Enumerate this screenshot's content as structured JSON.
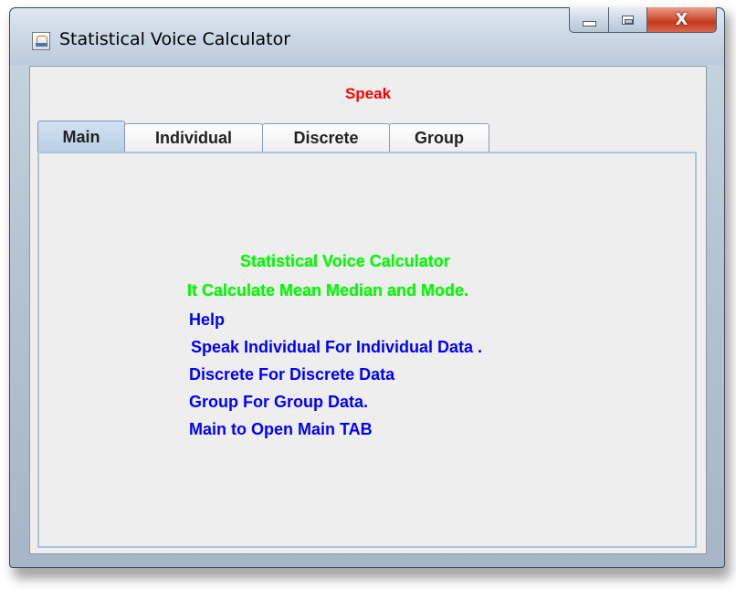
{
  "window": {
    "title": "Statistical Voice Calculator",
    "close_glyph": "X"
  },
  "speak_label": "Speak",
  "tabs": [
    {
      "label": "Main",
      "active": true
    },
    {
      "label": "Individual",
      "active": false
    },
    {
      "label": "Discrete",
      "active": false
    },
    {
      "label": "Group",
      "active": false
    }
  ],
  "main_panel": {
    "heading": "Statistical Voice Calculator",
    "description": "It Calculate Mean Median and Mode.",
    "help_title": "Help",
    "help_lines": [
      "Speak Individual For Individual Data .",
      "Discrete For Discrete Data",
      "Group For Group Data.",
      "Main to Open Main TAB"
    ]
  },
  "colors": {
    "speak_label": "#ff0000",
    "heading_text": "#00ff00",
    "help_text": "#0000ff",
    "close_button": "#c3391c"
  },
  "icons": {
    "app": "java-app-icon",
    "minimize": "minimize-icon",
    "maximize": "maximize-icon",
    "close": "close-icon"
  }
}
